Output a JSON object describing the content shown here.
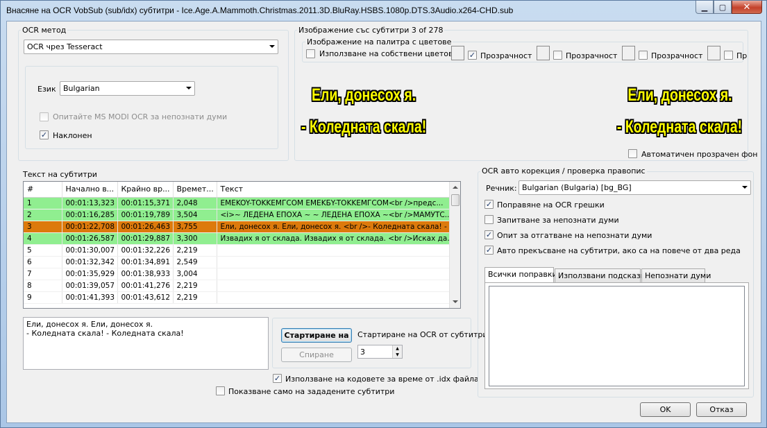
{
  "window": {
    "title": "Внасяне на OCR VobSub (sub/idx) субтитри - Ice.Age.A.Mammoth.Christmas.2011.3D.BluRay.HSBS.1080p.DTS.3Audio.x264-CHD.sub"
  },
  "ocr_method": {
    "group_label": "OCR метод",
    "method_value": "OCR чрез Tesseract",
    "language_label": "Език",
    "language_value": "Bulgarian",
    "modi_label": "Опитайте MS MODI OCR за непознати думи",
    "italic_label": "Наклонен"
  },
  "image_panel": {
    "group_label": "Изображение със субтитри 3 of 278",
    "palette_label": "Изображение на палитра с цветове",
    "use_own_colors_label": "Използване на собствени цветове",
    "transparency_label": "Прозрачност",
    "transparency_label_cut": "Пр",
    "subtitle_line1": "Ели, донесох я.",
    "subtitle_line2": "- Коледната скала!",
    "auto_transparent_label": "Автоматичен прозрачен фон"
  },
  "subtitles": {
    "group_label": "Текст на субтитри",
    "columns": [
      "#",
      "Начално в...",
      "Крайно вр...",
      "Времет...",
      "Текст"
    ],
    "rows": [
      {
        "num": "1",
        "start": "00:01:13,323",
        "end": "00:01:15,371",
        "dur": "2,048",
        "text": "EMEKOY-TOKKEMГCOM EMEKБY-TOKKEMГCOM<br />предс..."
      },
      {
        "num": "2",
        "start": "00:01:16,285",
        "end": "00:01:19,789",
        "dur": "3,504",
        "text": "<i>~ ЛЕДЕНА ЕПОХА ~ ~ ЛЕДЕНА ЕПОХА ~<br />МАМУТС..."
      },
      {
        "num": "3",
        "start": "00:01:22,708",
        "end": "00:01:26,463",
        "dur": "3,755",
        "text": "Ели, донесох я. Ели, донесох я. <br />- Коледната скала! - Коле"
      },
      {
        "num": "4",
        "start": "00:01:26,587",
        "end": "00:01:29,887",
        "dur": "3,300",
        "text": "Извадих я от склада. Извадих я от склада. <br />Исках да..."
      },
      {
        "num": "5",
        "start": "00:01:30,007",
        "end": "00:01:32,226",
        "dur": "2,219",
        "text": ""
      },
      {
        "num": "6",
        "start": "00:01:32,342",
        "end": "00:01:34,891",
        "dur": "2,549",
        "text": ""
      },
      {
        "num": "7",
        "start": "00:01:35,929",
        "end": "00:01:38,933",
        "dur": "3,004",
        "text": ""
      },
      {
        "num": "8",
        "start": "00:01:39,057",
        "end": "00:01:41,276",
        "dur": "2,219",
        "text": ""
      },
      {
        "num": "9",
        "start": "00:01:41,393",
        "end": "00:01:43,612",
        "dur": "2,219",
        "text": ""
      }
    ],
    "row_colors": {
      "ok": "#90ee90",
      "current": "#dd7a0c"
    },
    "current_text_line1": "Ели, донесох я. Ели, донесох я.",
    "current_text_line2": "- Коледната скала! - Коледната скала!"
  },
  "controls": {
    "start_button": "Стартиране на",
    "stop_button": "Спиране",
    "start_from_label": "Стартиране на OCR от субтитри",
    "start_from_value": "3",
    "use_idx_times_label": "Използване на кодовете за време от .idx файла",
    "show_only_forced_label": "Показване само на зададените субтитри"
  },
  "autocorrect": {
    "group_label": "OCR авто корекция / проверка правопис",
    "dictionary_label": "Речник:",
    "dictionary_value": "Bulgarian (Bulgaria) [bg_BG]",
    "fix_errors_label": "Поправяне на OCR грешки",
    "save_unknown_label": "Запитване за непознати думи",
    "guess_unknown_label": "Опит за отгатване на непознати думи",
    "auto_break_label": "Авто прекъсване на субтитри, ако са на повече от два реда",
    "tabs": [
      "Всички поправки",
      "Използвани подсказки",
      "Непознати думи"
    ]
  },
  "dialog": {
    "ok": "OK",
    "cancel": "Отказ"
  }
}
